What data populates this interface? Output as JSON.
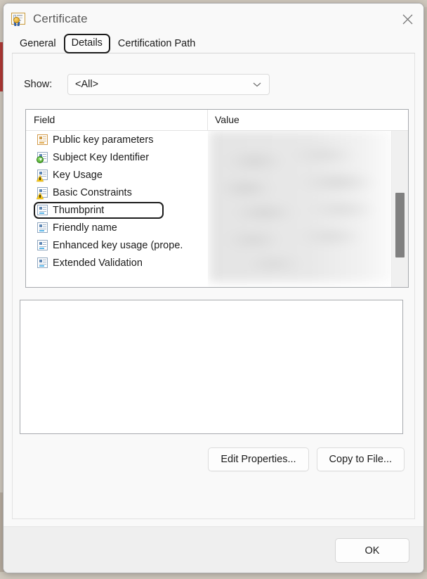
{
  "window": {
    "title": "Certificate",
    "icon": "certificate-icon",
    "close_icon": "close-icon"
  },
  "tabs": [
    {
      "label": "General",
      "selected": false
    },
    {
      "label": "Details",
      "selected": true
    },
    {
      "label": "Certification Path",
      "selected": false
    }
  ],
  "show": {
    "label": "Show:",
    "value": "<All>",
    "arrow_icon": "chevron-down-icon"
  },
  "grid": {
    "columns": [
      "Field",
      "Value"
    ],
    "rows": [
      {
        "label": "Public key parameters",
        "icon": "certificate-field-orange-icon",
        "focused": false
      },
      {
        "label": "Subject Key Identifier",
        "icon": "certificate-field-download-icon",
        "focused": false
      },
      {
        "label": "Key Usage",
        "icon": "certificate-field-warning-icon",
        "focused": false
      },
      {
        "label": "Basic Constraints",
        "icon": "certificate-field-warning-icon",
        "focused": false
      },
      {
        "label": "Thumbprint",
        "icon": "certificate-field-icon",
        "focused": true
      },
      {
        "label": "Friendly name",
        "icon": "certificate-field-icon",
        "focused": false
      },
      {
        "label": "Enhanced key usage (prope...",
        "icon": "certificate-field-icon",
        "focused": false
      },
      {
        "label": "Extended Validation",
        "icon": "certificate-field-icon",
        "focused": false
      }
    ],
    "value_column_content": "",
    "scrollbar": "vertical-scrollbar"
  },
  "details_text": "",
  "buttons": {
    "edit_properties": "Edit Properties...",
    "copy_to_file": "Copy to File...",
    "ok": "OK"
  },
  "colors": {
    "window_bg": "#f9f9f9",
    "footer_bg": "#efefef",
    "focus_outline": "#1c1c1c",
    "grid_border": "#a7aaae",
    "scroll_thumb": "#808080",
    "title_text": "#5a5a5a"
  }
}
